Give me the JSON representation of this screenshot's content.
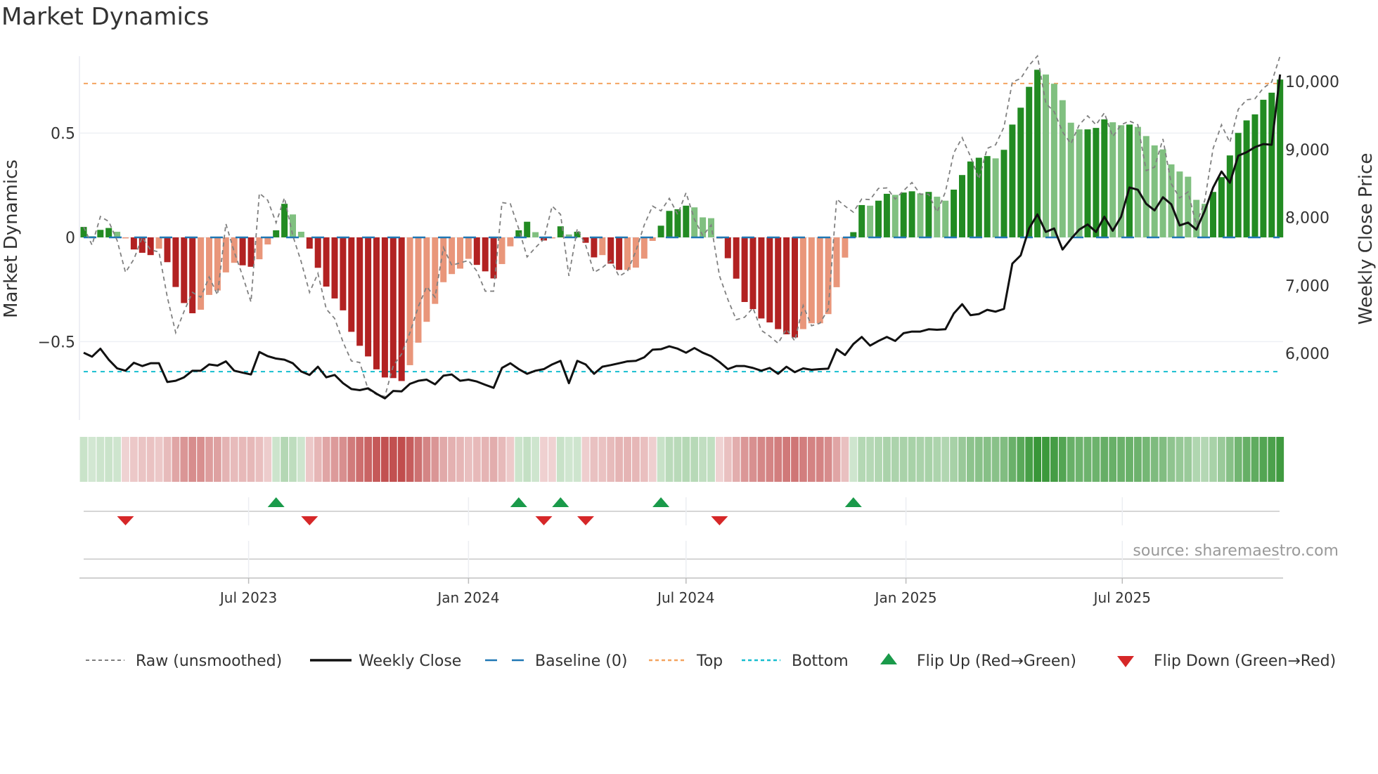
{
  "chart_data": {
    "type": "bar",
    "title": "Market Dynamics",
    "ylabel": "Market Dynamics",
    "y2label": "Weekly Close Price",
    "source": "source: sharemaestro.com",
    "start_date": "2023-02-13",
    "interval_days": 7,
    "ylim": [
      -0.876,
      0.869
    ],
    "y2lim": [
      5020,
      10372
    ],
    "yticks": [
      {
        "v": 0.5,
        "label": "0.5"
      },
      {
        "v": 0,
        "label": "0"
      },
      {
        "v": -0.5,
        "label": "−0.5"
      }
    ],
    "y2ticks": [
      {
        "v": 10000,
        "label": "10,000"
      },
      {
        "v": 9000,
        "label": "9,000"
      },
      {
        "v": 8000,
        "label": "8,000"
      },
      {
        "v": 7000,
        "label": "7,000"
      },
      {
        "v": 6000,
        "label": "6,000"
      }
    ],
    "xticks": [
      {
        "date": "2023-07-01",
        "label": "Jul 2023"
      },
      {
        "date": "2024-01-01",
        "label": "Jan 2024"
      },
      {
        "date": "2024-07-01",
        "label": "Jul 2024"
      },
      {
        "date": "2025-01-01",
        "label": "Jan 2025"
      },
      {
        "date": "2025-07-01",
        "label": "Jul 2025"
      }
    ],
    "top_threshold": 0.738,
    "bottom_threshold": -0.644,
    "baseline": 0,
    "grid": true,
    "legend_position": "bottom",
    "colors": {
      "strong_up": "#228b22",
      "weak_up": "#80c080",
      "strong_down": "#b22222",
      "weak_down": "#e9967a",
      "raw": "#808080",
      "close": "#111111",
      "baseline": "#1f77b4",
      "top": "#f4a460",
      "bottom": "#17becf",
      "flip_up": "#1a9a4a",
      "flip_down": "#d62728"
    },
    "series": [
      {
        "name": "Market Dynamics (smoothed)",
        "values": [
          0.05,
          0.005,
          0.036,
          0.045,
          0.027,
          -0.005,
          -0.058,
          -0.074,
          -0.085,
          -0.054,
          -0.119,
          -0.238,
          -0.315,
          -0.364,
          -0.347,
          -0.276,
          -0.255,
          -0.168,
          -0.122,
          -0.134,
          -0.141,
          -0.105,
          -0.034,
          0.034,
          0.161,
          0.11,
          0.027,
          -0.054,
          -0.146,
          -0.236,
          -0.293,
          -0.35,
          -0.453,
          -0.52,
          -0.571,
          -0.633,
          -0.672,
          -0.675,
          -0.689,
          -0.613,
          -0.505,
          -0.405,
          -0.319,
          -0.215,
          -0.176,
          -0.15,
          -0.103,
          -0.132,
          -0.163,
          -0.197,
          -0.128,
          -0.043,
          0.034,
          0.075,
          0.025,
          -0.015,
          -0.005,
          0.053,
          0.014,
          0.027,
          -0.026,
          -0.096,
          -0.085,
          -0.126,
          -0.156,
          -0.156,
          -0.145,
          -0.102,
          -0.017,
          0.056,
          0.127,
          0.135,
          0.152,
          0.144,
          0.096,
          0.092,
          -0.005,
          -0.1,
          -0.198,
          -0.31,
          -0.344,
          -0.389,
          -0.408,
          -0.44,
          -0.465,
          -0.48,
          -0.44,
          -0.412,
          -0.412,
          -0.368,
          -0.239,
          -0.097,
          0.025,
          0.155,
          0.152,
          0.176,
          0.209,
          0.204,
          0.215,
          0.221,
          0.211,
          0.218,
          0.195,
          0.176,
          0.229,
          0.299,
          0.364,
          0.382,
          0.39,
          0.379,
          0.42,
          0.541,
          0.622,
          0.722,
          0.804,
          0.781,
          0.737,
          0.658,
          0.55,
          0.518,
          0.518,
          0.525,
          0.566,
          0.552,
          0.538,
          0.541,
          0.53,
          0.486,
          0.441,
          0.422,
          0.35,
          0.316,
          0.291,
          0.18,
          0.161,
          0.218,
          0.289,
          0.393,
          0.501,
          0.561,
          0.59,
          0.66,
          0.694,
          0.757
        ],
        "strong": [
          1,
          1,
          1,
          1,
          0,
          0,
          1,
          1,
          1,
          0,
          1,
          1,
          1,
          1,
          0,
          0,
          0,
          0,
          0,
          1,
          1,
          0,
          0,
          1,
          1,
          0,
          0,
          1,
          1,
          1,
          1,
          1,
          1,
          1,
          1,
          1,
          1,
          1,
          1,
          0,
          0,
          0,
          0,
          0,
          0,
          0,
          0,
          1,
          1,
          1,
          0,
          0,
          1,
          1,
          0,
          1,
          0,
          1,
          0,
          1,
          1,
          1,
          0,
          1,
          1,
          0,
          0,
          0,
          0,
          1,
          1,
          1,
          1,
          0,
          0,
          0,
          1,
          1,
          1,
          1,
          1,
          1,
          1,
          1,
          1,
          1,
          0,
          0,
          0,
          0,
          0,
          0,
          1,
          1,
          0,
          1,
          1,
          0,
          1,
          1,
          0,
          1,
          0,
          0,
          1,
          1,
          1,
          1,
          1,
          0,
          1,
          1,
          1,
          1,
          1,
          0,
          0,
          0,
          0,
          0,
          1,
          1,
          1,
          0,
          0,
          1,
          0,
          0,
          0,
          0,
          0,
          0,
          0,
          0,
          0,
          1,
          1,
          1,
          1,
          1,
          1,
          1,
          1,
          1
        ]
      },
      {
        "name": "Raw (unsmoothed)",
        "values": [
          0.05,
          -0.037,
          0.1,
          0.076,
          -0.015,
          -0.168,
          -0.105,
          0,
          -0.06,
          -0.07,
          -0.287,
          -0.457,
          -0.355,
          -0.264,
          -0.287,
          -0.19,
          -0.276,
          0.065,
          -0.07,
          -0.185,
          -0.31,
          0.212,
          0.178,
          0.07,
          0.19,
          0.008,
          -0.117,
          -0.264,
          -0.173,
          -0.344,
          -0.389,
          -0.502,
          -0.593,
          -0.6,
          -0.729,
          -0.754,
          -0.763,
          -0.616,
          -0.559,
          -0.457,
          -0.332,
          -0.236,
          -0.287,
          -0.049,
          -0.134,
          -0.122,
          -0.111,
          -0.162,
          -0.258,
          -0.258,
          0.167,
          0.161,
          0.042,
          -0.094,
          -0.049,
          -0.009,
          0.15,
          0.11,
          -0.185,
          0.042,
          -0.037,
          -0.168,
          -0.145,
          -0.111,
          -0.187,
          -0.162,
          -0.066,
          0.059,
          0.15,
          0.127,
          0.187,
          0.11,
          0.214,
          0.087,
          0.008,
          0.059,
          -0.185,
          -0.298,
          -0.395,
          -0.383,
          -0.338,
          -0.446,
          -0.474,
          -0.508,
          -0.44,
          -0.497,
          -0.327,
          -0.424,
          -0.412,
          -0.344,
          0.184,
          0.15,
          0.121,
          0.184,
          0.181,
          0.235,
          0.237,
          0.184,
          0.224,
          0.263,
          0.207,
          0.207,
          0.121,
          0.218,
          0.405,
          0.478,
          0.388,
          0.28,
          0.427,
          0.444,
          0.529,
          0.745,
          0.762,
          0.825,
          0.87,
          0.643,
          0.603,
          0.506,
          0.449,
          0.54,
          0.583,
          0.54,
          0.597,
          0.483,
          0.54,
          0.558,
          0.54,
          0.32,
          0.337,
          0.472,
          0.257,
          0.189,
          0.218,
          0.059,
          0.178,
          0.427,
          0.54,
          0.455,
          0.614,
          0.66,
          0.665,
          0.716,
          0.745,
          0.87
        ]
      },
      {
        "name": "Weekly Close",
        "axis": "right",
        "values": [
          6010,
          5952,
          6069,
          5907,
          5780,
          5745,
          5862,
          5814,
          5855,
          5855,
          5579,
          5597,
          5648,
          5745,
          5745,
          5838,
          5821,
          5883,
          5745,
          5717,
          5690,
          6021,
          5959,
          5924,
          5907,
          5855,
          5734,
          5683,
          5804,
          5648,
          5683,
          5562,
          5476,
          5459,
          5486,
          5407,
          5338,
          5448,
          5441,
          5552,
          5597,
          5614,
          5545,
          5672,
          5690,
          5597,
          5614,
          5586,
          5538,
          5493,
          5786,
          5855,
          5769,
          5700,
          5745,
          5769,
          5838,
          5890,
          5562,
          5890,
          5838,
          5700,
          5804,
          5828,
          5855,
          5883,
          5890,
          5942,
          6055,
          6062,
          6104,
          6069,
          6010,
          6079,
          6010,
          5959,
          5873,
          5769,
          5814,
          5814,
          5786,
          5745,
          5786,
          5700,
          5804,
          5724,
          5780,
          5759,
          5769,
          5776,
          6062,
          5976,
          6138,
          6242,
          6114,
          6183,
          6242,
          6183,
          6297,
          6321,
          6321,
          6355,
          6348,
          6355,
          6586,
          6724,
          6562,
          6579,
          6641,
          6614,
          6655,
          7321,
          7442,
          7838,
          8045,
          7786,
          7838,
          7528,
          7683,
          7821,
          7897,
          7786,
          8010,
          7804,
          8010,
          8441,
          8407,
          8200,
          8104,
          8297,
          8193,
          7883,
          7924,
          7821,
          8097,
          8441,
          8676,
          8510,
          8907,
          8959,
          9034,
          9079,
          9069,
          10103
        ]
      }
    ],
    "flip_up_weeks": [
      23,
      52,
      57,
      69,
      92
    ],
    "flip_down_weeks": [
      5,
      27,
      55,
      60,
      76
    ],
    "legend": [
      {
        "key": "raw",
        "label": "Raw (unsmoothed)"
      },
      {
        "key": "close",
        "label": "Weekly Close"
      },
      {
        "key": "baseline",
        "label": "Baseline (0)"
      },
      {
        "key": "top",
        "label": "Top"
      },
      {
        "key": "bottom",
        "label": "Bottom"
      },
      {
        "key": "flip_up",
        "label": "Flip Up (Red→Green)"
      },
      {
        "key": "flip_down",
        "label": "Flip Down (Green→Red)"
      }
    ]
  }
}
